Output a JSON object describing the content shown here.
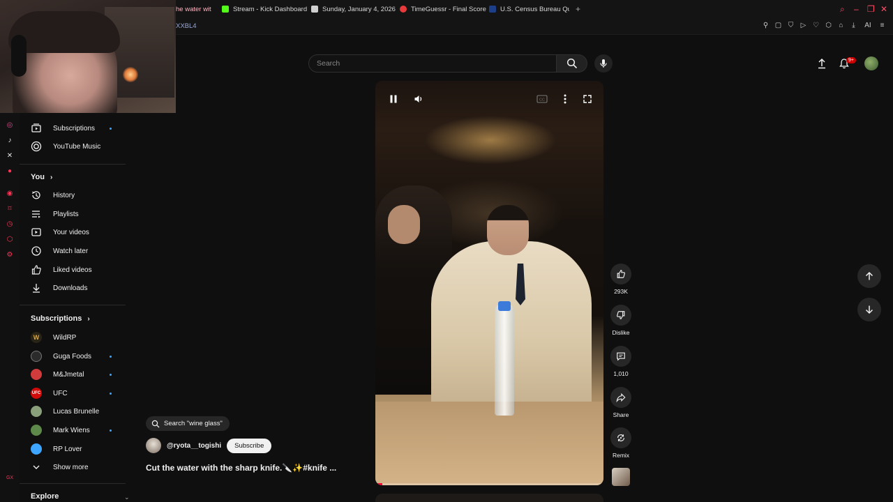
{
  "browser": {
    "tabs": [
      {
        "label": "he water wit",
        "color": "#ff2a55"
      },
      {
        "label": "Stream - Kick Dashboard",
        "color": "#53fc18"
      },
      {
        "label": "Sunday, January 4, 2026",
        "color": "#ffffff"
      },
      {
        "label": "TimeGuessr - Final Score",
        "color": "#e83a3a"
      },
      {
        "label": "U.S. Census Bureau Quick",
        "color": "#1d3f8a"
      }
    ],
    "new_tab": "+",
    "address": "XXBL4",
    "accent": "#ff4d6a"
  },
  "sidebar": {
    "top_items": [
      {
        "label": "Subscriptions",
        "icon": "subscriptions-icon",
        "dot": true
      },
      {
        "label": "YouTube Music",
        "icon": "youtube-music-icon",
        "dot": false
      }
    ],
    "you_header": "You",
    "you_items": [
      {
        "label": "History",
        "icon": "history-icon"
      },
      {
        "label": "Playlists",
        "icon": "playlists-icon"
      },
      {
        "label": "Your videos",
        "icon": "your-videos-icon"
      },
      {
        "label": "Watch later",
        "icon": "watch-later-icon"
      },
      {
        "label": "Liked videos",
        "icon": "liked-videos-icon"
      },
      {
        "label": "Downloads",
        "icon": "downloads-icon"
      }
    ],
    "subs_header": "Subscriptions",
    "subscriptions": [
      {
        "label": "WildRP",
        "color": "#c69a3e",
        "dot": false
      },
      {
        "label": "Guga Foods",
        "color": "#2b2b2b",
        "dot": true
      },
      {
        "label": "M&Jmetal",
        "color": "#d23b3b",
        "dot": true
      },
      {
        "label": "UFC",
        "color": "#d20a0a",
        "dot": true
      },
      {
        "label": "Lucas Brunelle",
        "color": "#8aa07a",
        "dot": false
      },
      {
        "label": "Mark Wiens",
        "color": "#5d8a4a",
        "dot": true
      },
      {
        "label": "RP Lover",
        "color": "#3ea6ff",
        "dot": false
      }
    ],
    "show_more": "Show more",
    "explore": "Explore"
  },
  "header": {
    "search_placeholder": "Search",
    "notification_count": "9+"
  },
  "short": {
    "search_chip": "Search \"wine glass\"",
    "channel": "@ryota__togishi",
    "subscribe": "Subscribe",
    "title": "Cut the water with the sharp knife.🔪✨#knife ...",
    "progress": 0.03
  },
  "actions": {
    "likes": "293K",
    "dislike": "Dislike",
    "comments": "1,010",
    "share": "Share",
    "remix": "Remix"
  }
}
